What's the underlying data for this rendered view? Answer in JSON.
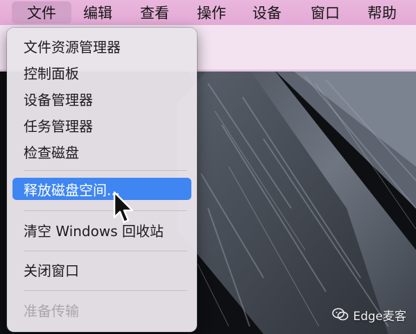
{
  "menubar": {
    "items": [
      {
        "label": "文件",
        "active": true
      },
      {
        "label": "编辑",
        "active": false
      },
      {
        "label": "查看",
        "active": false
      },
      {
        "label": "操作",
        "active": false
      },
      {
        "label": "设备",
        "active": false
      },
      {
        "label": "窗口",
        "active": false
      },
      {
        "label": "帮助",
        "active": false
      }
    ]
  },
  "file_menu": {
    "items": [
      {
        "label": "文件资源管理器",
        "state": "normal"
      },
      {
        "label": "控制面板",
        "state": "normal"
      },
      {
        "label": "设备管理器",
        "state": "normal"
      },
      {
        "label": "任务管理器",
        "state": "normal"
      },
      {
        "label": "检查磁盘",
        "state": "normal"
      },
      {
        "label": "释放磁盘空间...",
        "state": "selected"
      },
      {
        "label": "清空 Windows 回收站",
        "state": "normal"
      },
      {
        "label": "关闭窗口",
        "state": "normal"
      },
      {
        "label": "准备传输",
        "state": "disabled"
      }
    ]
  },
  "watermark": {
    "text": "Edge麦客",
    "icon": "wechat-icon"
  },
  "colors": {
    "menubar": "#e6b0d9",
    "menu_background": "#e8e3e9",
    "selection": "#3f86f2",
    "disabled_text": "#a9a6ab"
  }
}
